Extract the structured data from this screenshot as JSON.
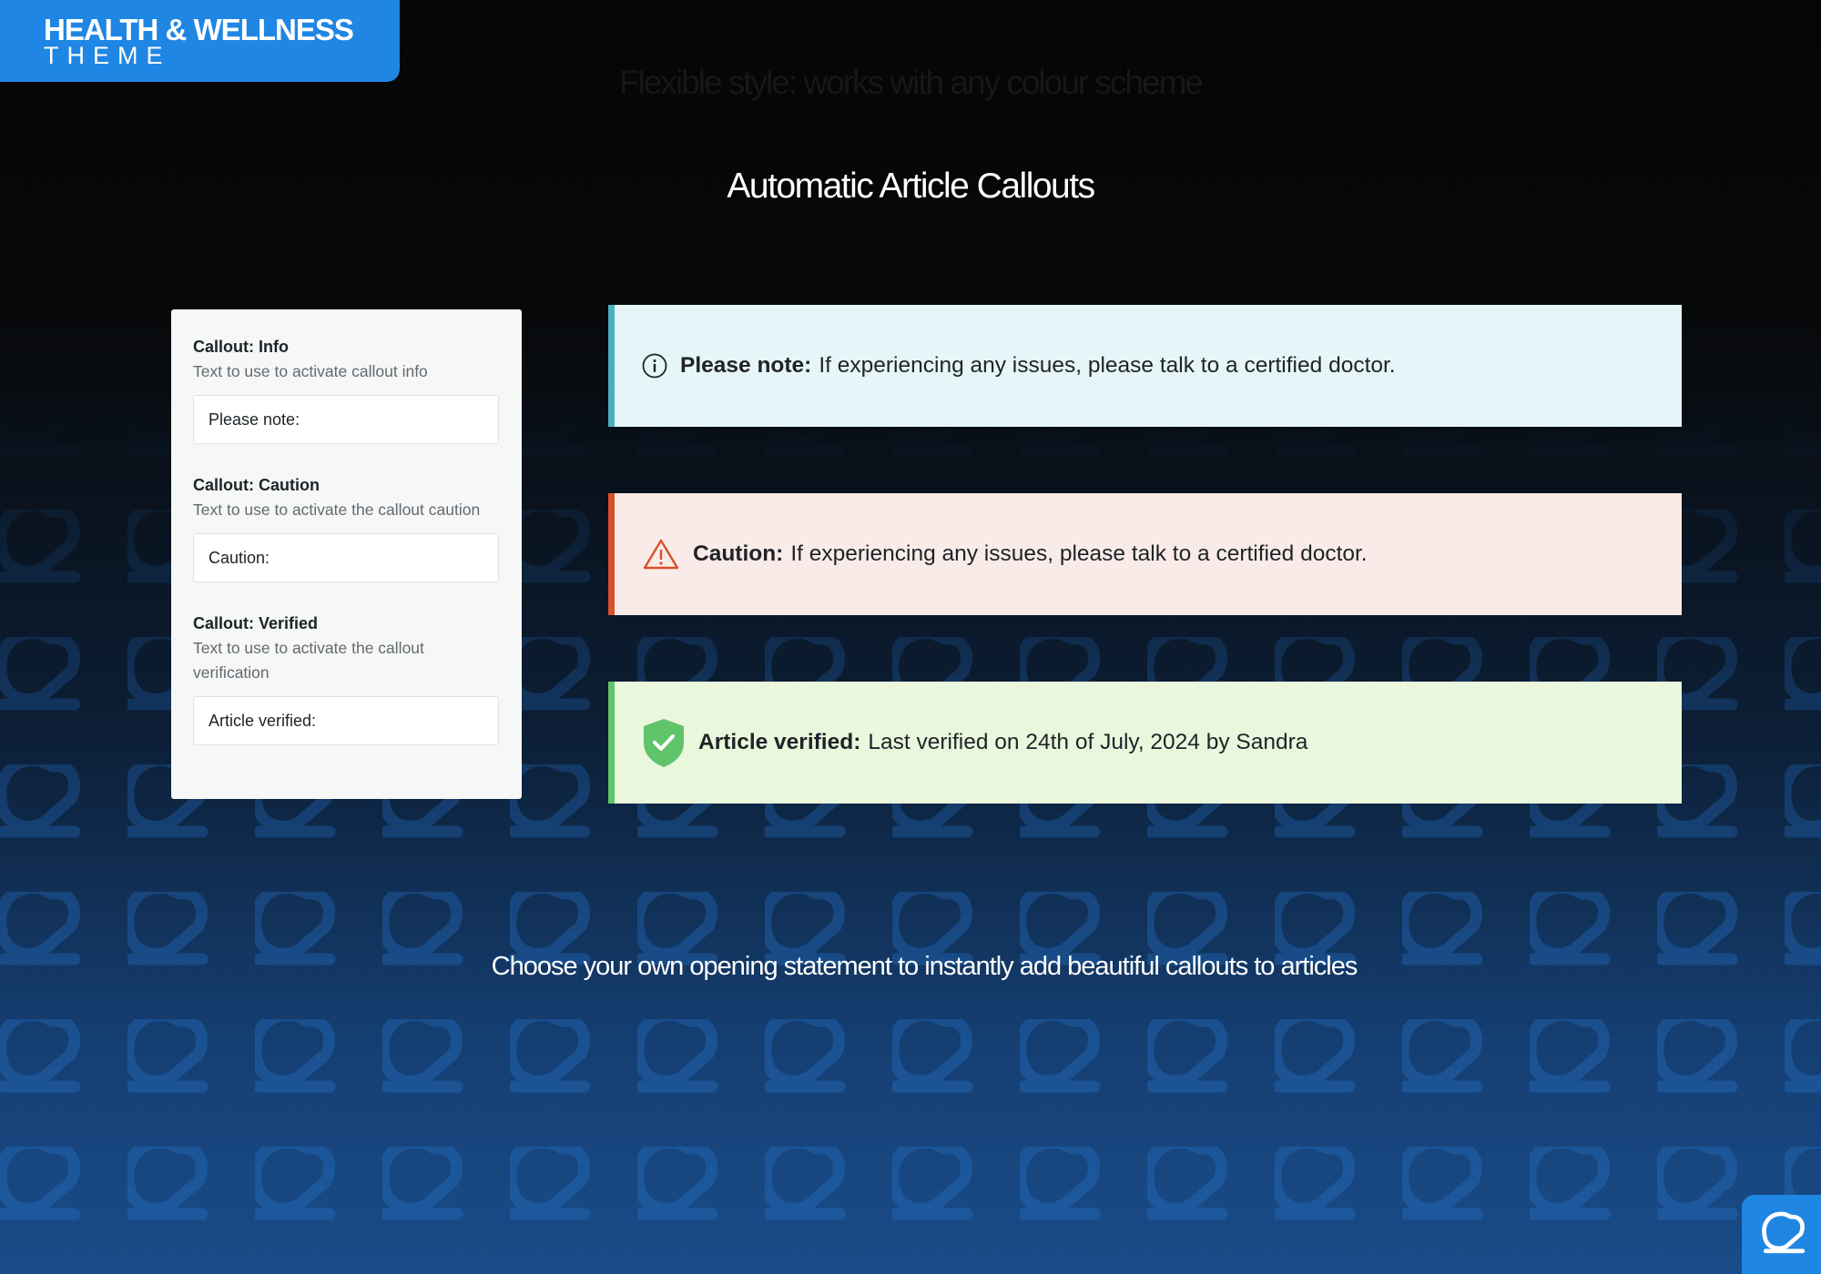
{
  "badge": {
    "title": "HEALTH & WELLNESS",
    "subtitle": "THEME"
  },
  "tagline": "Flexible style: works with any colour scheme",
  "main_title": "Automatic Article Callouts",
  "settings": {
    "fields": [
      {
        "label": "Callout: Info",
        "description": "Text to use to activate callout info",
        "value": "Please note:"
      },
      {
        "label": "Callout: Caution",
        "description": "Text to use to activate the callout caution",
        "value": "Caution:"
      },
      {
        "label": "Callout: Verified",
        "description": "Text to use to activate the callout verification",
        "value": "Article verified:"
      }
    ]
  },
  "callouts": {
    "info": {
      "lead": "Please note:",
      "text": "If experiencing any issues, please talk to a certified doctor.",
      "icon": "info-circle-icon",
      "accent": "#49b0bd",
      "background": "#e6f5f8"
    },
    "caution": {
      "lead": "Caution:",
      "text": "If experiencing any issues, please talk to a certified doctor.",
      "icon": "warning-triangle-icon",
      "accent": "#d9502c",
      "background": "#f9ebe7"
    },
    "verified": {
      "lead": "Article verified:",
      "text": "Last verified on 24th of July, 2024 by Sandra",
      "icon": "shield-check-icon",
      "accent": "#5fc46a",
      "background": "#e9f7dc"
    }
  },
  "footer": "Choose your own opening statement to instantly add beautiful callouts to articles",
  "colors": {
    "brand_blue": "#1f86e3",
    "pattern_blue": "#1f5fa8"
  }
}
